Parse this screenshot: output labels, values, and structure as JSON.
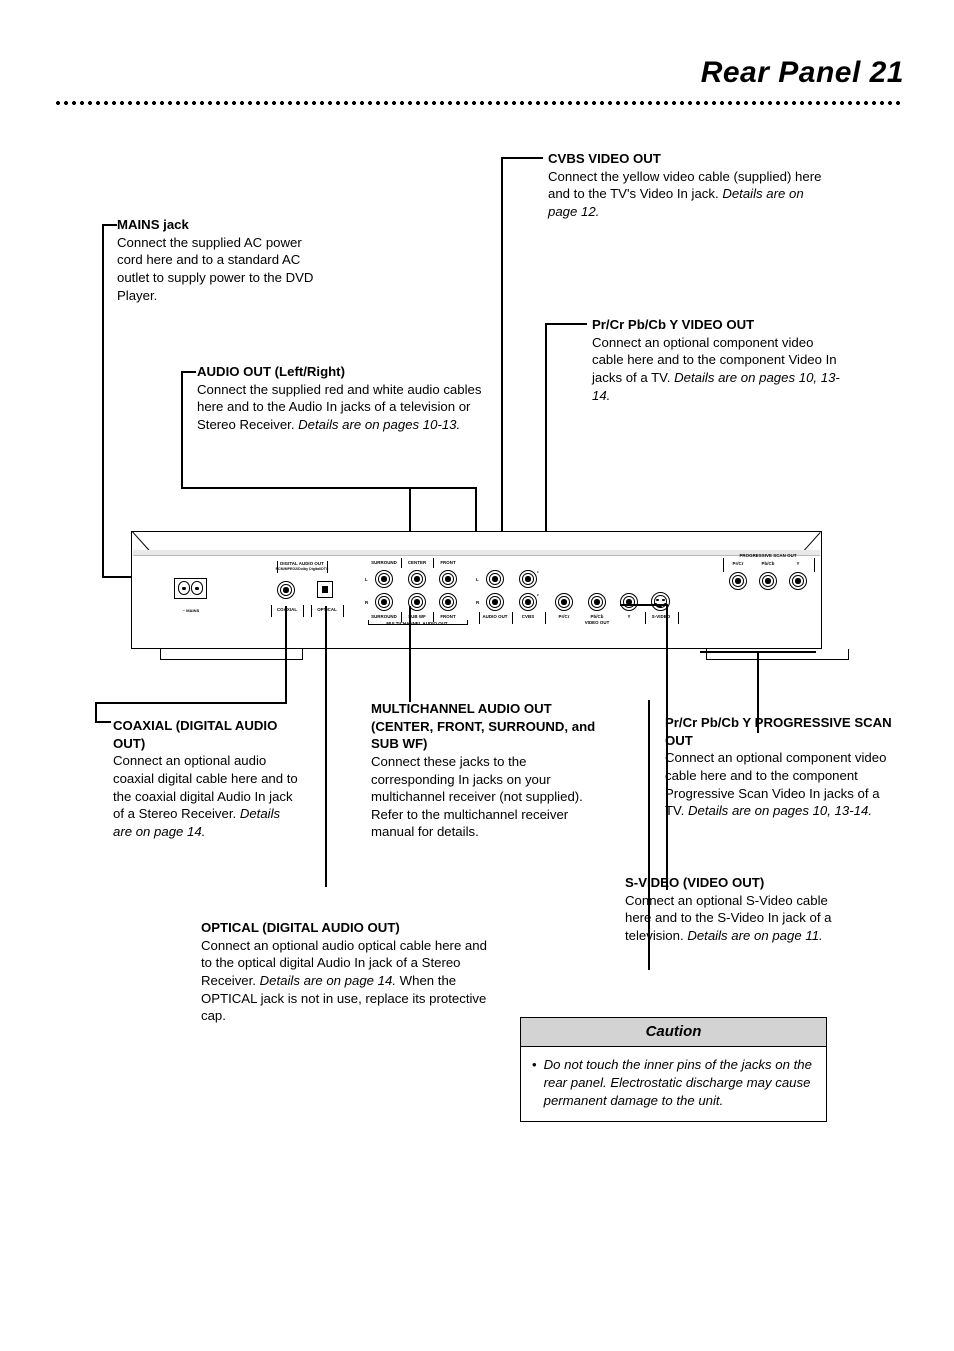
{
  "header": {
    "title": "Rear Panel  21"
  },
  "callouts": {
    "mains": {
      "title": "MAINS jack",
      "body": "Connect the supplied AC power cord here and to  a standard AC outlet to supply power to the DVD Player."
    },
    "audio_out": {
      "title": "AUDIO OUT (Left/Right)",
      "body": "Connect the supplied red and white audio cables here and to the Audio In jacks of a television or Stereo Receiver. ",
      "italic": "Details are on pages 10-13."
    },
    "cvbs": {
      "title": "CVBS VIDEO OUT",
      "body": "Connect the yellow video cable (supplied) here and to the TV's Video In jack. ",
      "italic": "Details are on page 12."
    },
    "component_video": {
      "title": "Pr/Cr Pb/Cb Y VIDEO OUT",
      "body": "Connect an optional component video cable here and to the component Video In jacks of a TV. ",
      "italic": "Details are on pages 10, 13-14."
    },
    "coaxial": {
      "title": "COAXIAL (DIGITAL AUDIO OUT)",
      "body": "Connect an optional audio coaxial digital cable here and to the coaxial digital Audio In jack of a Stereo Receiver. ",
      "italic": "Details are on page 14."
    },
    "multichannel": {
      "title": "MULTICHANNEL AUDIO OUT (CENTER, FRONT, SURROUND, and SUB WF)",
      "body": "Connect these jacks to the corresponding In jacks on your multichannel receiver (not supplied). Refer to the multichannel receiver manual for details."
    },
    "progressive": {
      "title": "Pr/Cr Pb/Cb Y PROGRESSIVE SCAN OUT",
      "body": "Connect an optional component video cable here and to the component Progressive Scan Video In jacks of a TV. ",
      "italic": "Details are on pages 10, 13-14."
    },
    "optical": {
      "title": "OPTICAL (DIGITAL AUDIO OUT)",
      "body1": "Connect an optional audio optical cable here and to the optical digital Audio In jack of a Stereo Receiver. ",
      "italic": "Details are on page 14.",
      "body2": " When the OPTICAL jack is not in use, replace its protective cap."
    },
    "svideo": {
      "title": "S-VIDEO (VIDEO OUT)",
      "body": "Connect an optional S-Video cable here and to the S-Video In jack of a television. ",
      "italic": "Details are on page 11."
    }
  },
  "panel": {
    "mains_label": "~ MAINS",
    "digital_audio_out": "DIGITAL AUDIO OUT",
    "digital_audio_formats": "PCM/MPEG2/Dolby Digital/DTS",
    "coaxial_label": "COAXIAL",
    "optical_label": "OPTICAL",
    "mc_top": [
      "SURROUND",
      "CENTER",
      "FRONT"
    ],
    "mc_bottom": [
      "SURROUND",
      "SUB WF",
      "FRONT"
    ],
    "mc_group": "MULTICHANNEL AUDIO OUT",
    "row_left_top": "L",
    "row_left_bottom": "R",
    "audio_out_label": "AUDIO OUT",
    "cvbs_label": "CVBS",
    "cvbs_sup_top": "1",
    "cvbs_sup_bottom": "2",
    "video_out_group": "VIDEO OUT",
    "video_out_jacks": [
      "Pr/Cr",
      "Pb/Cb",
      "Y"
    ],
    "svideo_label": "S-VIDEO",
    "progressive_group": "PROGRESSIVE SCAN OUT",
    "progressive_jacks": [
      "Pr/Cr",
      "Pb/Cb",
      "Y"
    ]
  },
  "caution": {
    "title": "Caution",
    "bullet": "•",
    "text": "Do not touch the inner pins of the jacks on the rear panel. Electrostatic discharge may cause permanent damage to the unit."
  }
}
